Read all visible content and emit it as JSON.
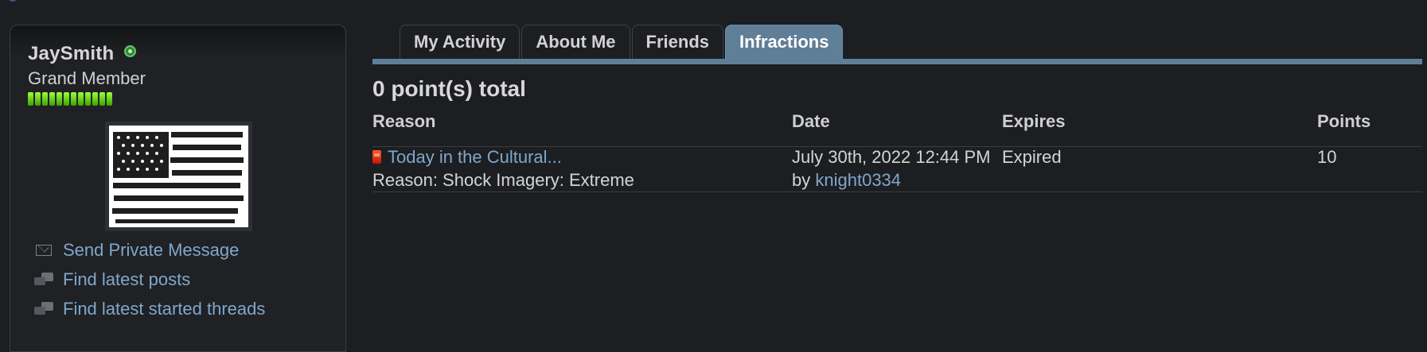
{
  "profile": {
    "username": "JaySmith",
    "user_title": "Grand Member",
    "reputation_pips": 12,
    "links": [
      {
        "label": "Send Private Message",
        "icon": "envelope-icon"
      },
      {
        "label": "Find latest posts",
        "icon": "chat-bubbles-icon"
      },
      {
        "label": "Find latest started threads",
        "icon": "chat-bubbles-icon"
      }
    ]
  },
  "tabs": [
    {
      "label": "My Activity",
      "active": false
    },
    {
      "label": "About Me",
      "active": false
    },
    {
      "label": "Friends",
      "active": false
    },
    {
      "label": "Infractions",
      "active": true
    }
  ],
  "infractions": {
    "total": "0 point(s) total",
    "headers": {
      "reason": "Reason",
      "date": "Date",
      "expires": "Expires",
      "points": "Points"
    },
    "rows": [
      {
        "thread": "Today in the Cultural...",
        "reason": "Reason: Shock Imagery: Extreme",
        "date": "July 30th, 2022 12:44 PM",
        "by_prefix": "by",
        "by_user": "knight0334",
        "expires": "Expired",
        "points": "10"
      }
    ]
  },
  "colors": {
    "background": "#1c1e21",
    "accent_tab": "#5f7e97",
    "link": "#7fa7cc",
    "reputation": "#6bd11c"
  }
}
